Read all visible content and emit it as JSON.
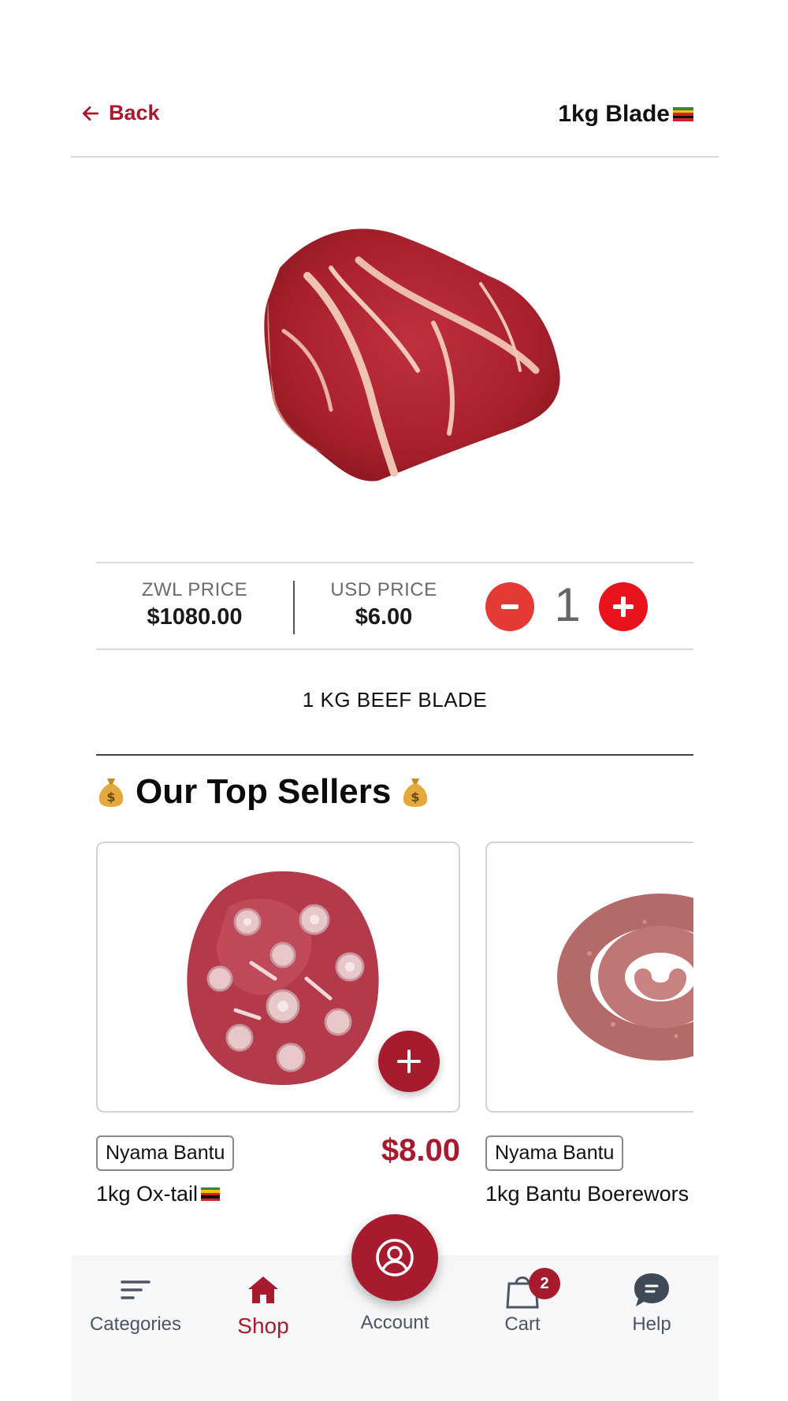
{
  "header": {
    "back_label": "Back",
    "title": "1kg Blade"
  },
  "product": {
    "image": "beef-blade-photo",
    "zwl_price_label": "ZWL PRICE",
    "zwl_price": "$1080.00",
    "usd_price_label": "USD PRICE",
    "usd_price": "$6.00",
    "quantity": "1",
    "description": "1 KG BEEF BLADE"
  },
  "top_sellers": {
    "title": "Our Top Sellers",
    "items": [
      {
        "vendor": "Nyama Bantu",
        "price": "$8.00",
        "name": "1kg Ox-tail",
        "image": "oxtail-photo",
        "flag": true
      },
      {
        "vendor": "Nyama Bantu",
        "price": "",
        "name": "1kg Bantu Boerewors",
        "image": "boerewors-photo",
        "flag": false
      }
    ]
  },
  "nav": {
    "categories": "Categories",
    "shop": "Shop",
    "account": "Account",
    "cart": "Cart",
    "cart_badge": "2",
    "help": "Help"
  },
  "colors": {
    "brand": "#a61c2e",
    "qty_minus": "#e53935",
    "qty_plus": "#e8131d",
    "text_muted": "#6b6b6b"
  }
}
